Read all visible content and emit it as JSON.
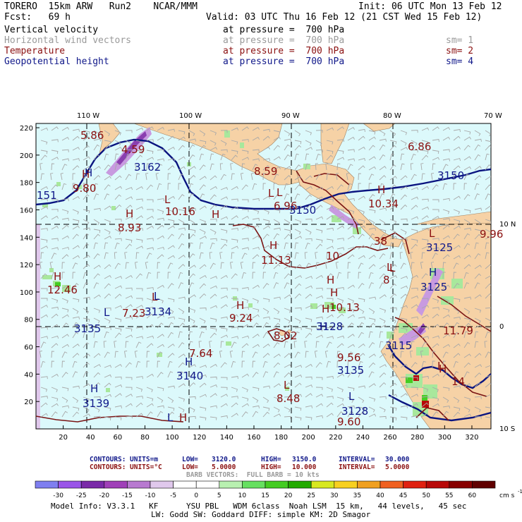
{
  "header": {
    "model": "TORERO  15km ARW   Run2    NCAR/MMM",
    "init": "Init: 06 UTC Mon 13 Feb 12",
    "fcst": "Fcst:   69 h",
    "valid": "Valid: 03 UTC Thu 16 Feb 12 (21 CST Wed 15 Feb 12)"
  },
  "fields": [
    {
      "name": "Vertical velocity",
      "level": "at pressure =  700 hPa",
      "sm": "",
      "color": "#000000"
    },
    {
      "name": "Horizontal wind vectors",
      "level": "at pressure =  700 hPa",
      "sm": "sm= 1",
      "color": "#9a9a9a"
    },
    {
      "name": "Temperature",
      "level": "at pressure =  700 hPa",
      "sm": "sm= 2",
      "color": "#8b1010"
    },
    {
      "name": "Geopotential height",
      "level": "at pressure =  700 hPa",
      "sm": "sm= 4",
      "color": "#10188a"
    }
  ],
  "map": {
    "top_lon_labels": [
      "110 W",
      "100 W",
      "90 W",
      "80 W",
      "70 W"
    ],
    "right_lat_labels": [
      "10 N",
      "0",
      "10 S"
    ],
    "y_ticks": [
      "220",
      "200",
      "180",
      "160",
      "140",
      "120",
      "100",
      "80",
      "60",
      "40",
      "20"
    ],
    "x_ticks": [
      "20",
      "40",
      "60",
      "80",
      "100",
      "120",
      "140",
      "160",
      "180",
      "200",
      "220",
      "240",
      "260",
      "280",
      "300",
      "320"
    ],
    "labels": [
      {
        "t": "5.86",
        "c": "red"
      },
      {
        "t": "4.59",
        "c": "red"
      },
      {
        "t": "3162",
        "c": "blue"
      },
      {
        "t": "9.80",
        "c": "red"
      },
      {
        "t": "H",
        "c": "red"
      },
      {
        "t": "H",
        "c": "blue"
      },
      {
        "t": "151",
        "c": "blue"
      },
      {
        "t": "H",
        "c": "red"
      },
      {
        "t": "8.93",
        "c": "red"
      },
      {
        "t": "L",
        "c": "red"
      },
      {
        "t": "10.16",
        "c": "red"
      },
      {
        "t": "H",
        "c": "red"
      },
      {
        "t": "8.59",
        "c": "red"
      },
      {
        "t": "L",
        "c": "red"
      },
      {
        "t": "6.86",
        "c": "red"
      },
      {
        "t": "3150",
        "c": "blue"
      },
      {
        "t": "H",
        "c": "red"
      },
      {
        "t": "10.34",
        "c": "red"
      },
      {
        "t": "L",
        "c": "red"
      },
      {
        "t": "6.96",
        "c": "red"
      },
      {
        "t": "3150",
        "c": "blue"
      },
      {
        "t": "H",
        "c": "red"
      },
      {
        "t": "11.13",
        "c": "red"
      },
      {
        "t": "10",
        "c": "red"
      },
      {
        "t": "38",
        "c": "red"
      },
      {
        "t": "3125",
        "c": "blue"
      },
      {
        "t": "9.96",
        "c": "red"
      },
      {
        "t": "L",
        "c": "red"
      },
      {
        "t": "L",
        "c": "red"
      },
      {
        "t": "8",
        "c": "red"
      },
      {
        "t": "H",
        "c": "blue"
      },
      {
        "t": "3125",
        "c": "blue"
      },
      {
        "t": "H",
        "c": "red"
      },
      {
        "t": "12.46",
        "c": "red"
      },
      {
        "t": "H",
        "c": "red"
      },
      {
        "t": "L",
        "c": "red"
      },
      {
        "t": "L",
        "c": "blue"
      },
      {
        "t": "7.23",
        "c": "red"
      },
      {
        "t": "3134",
        "c": "blue"
      },
      {
        "t": "L",
        "c": "blue"
      },
      {
        "t": "3135",
        "c": "blue"
      },
      {
        "t": "H",
        "c": "red"
      },
      {
        "t": "9.24",
        "c": "red"
      },
      {
        "t": "H",
        "c": "red"
      },
      {
        "t": "10.13",
        "c": "red"
      },
      {
        "t": "H",
        "c": "blue"
      },
      {
        "t": "3128",
        "c": "blue"
      },
      {
        "t": "8.02",
        "c": "red"
      },
      {
        "t": "L",
        "c": "red"
      },
      {
        "t": "11.79",
        "c": "red"
      },
      {
        "t": "L",
        "c": "red"
      },
      {
        "t": "3115",
        "c": "blue"
      },
      {
        "t": "7.64",
        "c": "red"
      },
      {
        "t": "H",
        "c": "blue"
      },
      {
        "t": "3140",
        "c": "blue"
      },
      {
        "t": "H",
        "c": "red"
      },
      {
        "t": "9.56",
        "c": "red"
      },
      {
        "t": "3135",
        "c": "blue"
      },
      {
        "t": "H",
        "c": "red"
      },
      {
        "t": "H",
        "c": "blue"
      },
      {
        "t": "3139",
        "c": "blue"
      },
      {
        "t": "L",
        "c": "red"
      },
      {
        "t": "8.48",
        "c": "red"
      },
      {
        "t": "L",
        "c": "blue"
      },
      {
        "t": "3128",
        "c": "blue"
      },
      {
        "t": "9.60",
        "c": "red"
      },
      {
        "t": "L",
        "c": "blue"
      },
      {
        "t": "H",
        "c": "red"
      },
      {
        "t": "14",
        "c": "red"
      }
    ]
  },
  "contours": {
    "height": {
      "label": "CONTOURS:",
      "units": "UNITS=m",
      "low_label": "LOW=",
      "low": "3120.0",
      "high_label": "HIGH=",
      "high": "3150.0",
      "interval_label": "INTERVAL=",
      "interval": "30.000"
    },
    "temp": {
      "label": "CONTOURS:",
      "units": "UNITS=°C",
      "low_label": "LOW=",
      "low": "5.0000",
      "high_label": "HIGH=",
      "high": "10.000",
      "interval_label": "INTERVAL=",
      "interval": "5.0000"
    },
    "barb": "BARB VECTORS:  FULL BARB = 10 kts"
  },
  "colorbar": {
    "labels": [
      "-30",
      "-25",
      "-20",
      "-15",
      "-10",
      "-5",
      "0",
      "5",
      "10",
      "15",
      "20",
      "25",
      "30",
      "35",
      "40",
      "45",
      "50",
      "55",
      "60"
    ],
    "unit": "cm s",
    "unit_exp": "-1",
    "colors": [
      "#7f7ff0",
      "#9a55e8",
      "#7a2aa8",
      "#a040b8",
      "#b87ad0",
      "#e0c8ec",
      "#ffffff",
      "#ffffff",
      "#b8f0b0",
      "#66e060",
      "#44cc22",
      "#22aa00",
      "#d8e820",
      "#f8d020",
      "#f0a020",
      "#f06020",
      "#e02010",
      "#b80808",
      "#880000",
      "#600000"
    ]
  },
  "footer": {
    "line1": "Model Info: V3.3.1   KF      YSU PBL   WDM 6class  Noah LSM  15 km,   44 levels,   45 sec",
    "line2": "LW: Godd SW: Goddard DIFF: simple KM: 2D Smagor"
  }
}
